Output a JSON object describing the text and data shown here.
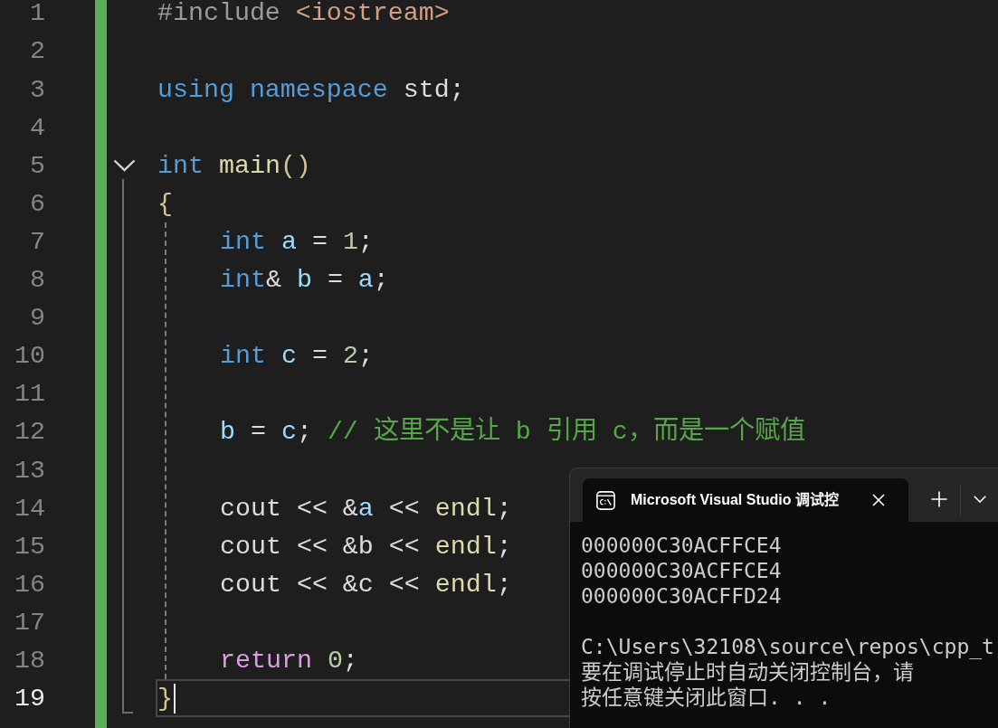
{
  "editor": {
    "lines": [
      {
        "number": "1",
        "current": false,
        "tokens": [
          {
            "kind": "preprocessor",
            "text": "#include "
          },
          {
            "kind": "string",
            "text": "<iostream>"
          }
        ]
      },
      {
        "number": "2",
        "current": false
      },
      {
        "number": "3",
        "current": false,
        "tokens": [
          {
            "kind": "keyword",
            "text": "using namespace "
          },
          {
            "kind": "plain",
            "text": "std;"
          }
        ]
      },
      {
        "number": "4",
        "current": false
      },
      {
        "number": "5",
        "current": false,
        "expanded": true,
        "tokens": [
          {
            "kind": "keyword",
            "text": "int "
          },
          {
            "kind": "function",
            "text": "main"
          },
          {
            "kind": "bracket",
            "text": "()"
          }
        ],
        "children": [
          {
            "number": "6",
            "current": false,
            "tokens": [
              {
                "kind": "bracket",
                "text": "{"
              }
            ],
            "children": [
              {
                "number": "7",
                "current": false,
                "tokens": [
                  {
                    "kind": "keyword",
                    "text": "int "
                  },
                  {
                    "kind": "variable",
                    "text": "a"
                  },
                  {
                    "kind": "plain",
                    "text": " = "
                  },
                  {
                    "kind": "number",
                    "text": "1"
                  },
                  {
                    "kind": "plain",
                    "text": ";"
                  }
                ]
              },
              {
                "number": "8",
                "current": false,
                "tokens": [
                  {
                    "kind": "keyword",
                    "text": "int"
                  },
                  {
                    "kind": "plain",
                    "text": "& "
                  },
                  {
                    "kind": "variable",
                    "text": "b"
                  },
                  {
                    "kind": "plain",
                    "text": " = "
                  },
                  {
                    "kind": "variable",
                    "text": "a"
                  },
                  {
                    "kind": "plain",
                    "text": ";"
                  }
                ]
              },
              {
                "number": "9",
                "current": false
              },
              {
                "number": "10",
                "current": false,
                "tokens": [
                  {
                    "kind": "keyword",
                    "text": "int "
                  },
                  {
                    "kind": "variable",
                    "text": "c"
                  },
                  {
                    "kind": "plain",
                    "text": " = "
                  },
                  {
                    "kind": "number",
                    "text": "2"
                  },
                  {
                    "kind": "plain",
                    "text": ";"
                  }
                ]
              },
              {
                "number": "11",
                "current": false
              },
              {
                "number": "12",
                "current": false,
                "tokens": [
                  {
                    "kind": "variable",
                    "text": "b"
                  },
                  {
                    "kind": "plain",
                    "text": " = "
                  },
                  {
                    "kind": "variable",
                    "text": "c"
                  },
                  {
                    "kind": "plain",
                    "text": "; "
                  },
                  {
                    "kind": "comment",
                    "text": "// 这里不是让 b 引用 c，而是一个赋值"
                  }
                ]
              },
              {
                "number": "13",
                "current": false
              },
              {
                "number": "14",
                "current": false,
                "tokens": [
                  {
                    "kind": "plain",
                    "text": "cout << &"
                  },
                  {
                    "kind": "variable",
                    "text": "a"
                  },
                  {
                    "kind": "plain",
                    "text": " << "
                  },
                  {
                    "kind": "function",
                    "text": "endl"
                  },
                  {
                    "kind": "plain",
                    "text": ";"
                  }
                ]
              },
              {
                "number": "15",
                "current": false,
                "tokens": [
                  {
                    "kind": "plain",
                    "text": "cout << &b << "
                  },
                  {
                    "kind": "function",
                    "text": "endl"
                  },
                  {
                    "kind": "plain",
                    "text": ";"
                  }
                ]
              },
              {
                "number": "16",
                "current": false,
                "tokens": [
                  {
                    "kind": "plain",
                    "text": "cout << &c << "
                  },
                  {
                    "kind": "function",
                    "text": "endl"
                  },
                  {
                    "kind": "plain",
                    "text": ";"
                  }
                ]
              },
              {
                "number": "17",
                "current": false
              },
              {
                "number": "18",
                "current": false,
                "tokens": [
                  {
                    "kind": "control",
                    "text": "return "
                  },
                  {
                    "kind": "number",
                    "text": "0"
                  },
                  {
                    "kind": "plain",
                    "text": ";"
                  }
                ]
              }
            ]
          },
          {
            "number": "19",
            "current": true,
            "tokens": [
              {
                "kind": "bracket",
                "text": "}"
              }
            ]
          }
        ]
      }
    ]
  },
  "console": {
    "tabs": [
      {
        "title": "Microsoft Visual Studio 调试控",
        "selected": true
      }
    ],
    "output": [
      "000000C30ACFFCE4",
      "000000C30ACFFCE4",
      "000000C30ACFFD24"
    ],
    "messages": [
      "C:\\Users\\32108\\source\\repos\\cpp_t",
      "要在调试停止时自动关闭控制台，请",
      "按任意键关闭此窗口. . ."
    ]
  }
}
